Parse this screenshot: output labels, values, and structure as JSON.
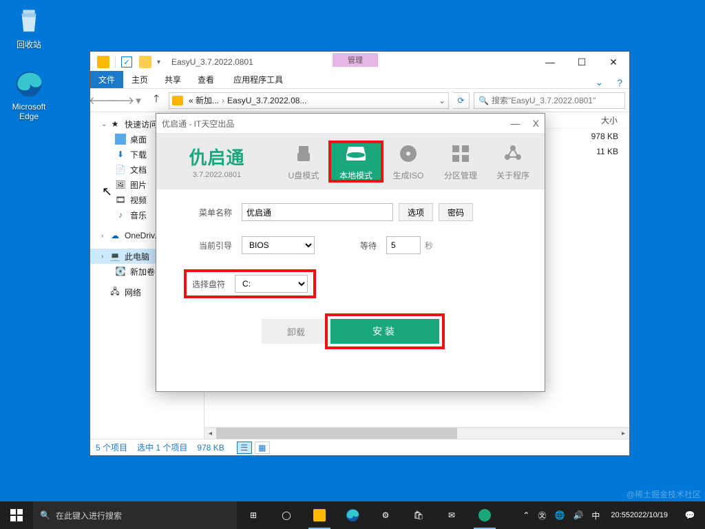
{
  "desktop": {
    "recycle": "回收站",
    "edge": "Microsoft Edge"
  },
  "explorer": {
    "window_title": "EasyU_3.7.2022.0801",
    "tool_tab_header": "管理",
    "tabs": {
      "file": "文件",
      "home": "主页",
      "share": "共享",
      "view": "查看",
      "apptools": "应用程序工具"
    },
    "nav": {
      "breadcrumb_root": "«  新加...",
      "breadcrumb_folder": "EasyU_3.7.2022.08...",
      "search_placeholder": "搜索\"EasyU_3.7.2022.0801\""
    },
    "sidebar": {
      "quick": "快速访问",
      "desktop": "桌面",
      "downloads": "下载",
      "documents": "文档",
      "pictures": "图片",
      "videos": "视频",
      "music": "音乐",
      "onedrive": "OneDriv...",
      "thispc": "此电脑",
      "volume": "新加卷 (...",
      "network": "网络"
    },
    "columns": {
      "size": "大小"
    },
    "rows": [
      {
        "size": "978 KB"
      },
      {
        "size": "11 KB"
      }
    ],
    "status": {
      "count": "5 个项目",
      "selected": "选中 1 个项目",
      "size": "978 KB"
    }
  },
  "easyu": {
    "title": "优启通 - IT天空出品",
    "brand": "仇启通",
    "version": "3.7.2022.0801",
    "tabs": {
      "usb": "U盘模式",
      "local": "本地模式",
      "iso": "生成ISO",
      "part": "分区管理",
      "about": "关于程序"
    },
    "menu_name_label": "菜单名称",
    "menu_name_value": "优启通",
    "options": "选项",
    "password": "密码",
    "boot_label": "当前引导",
    "boot_value": "BIOS",
    "wait_label": "等待",
    "wait_value": "5",
    "seconds": "秒",
    "drive_label": "选择盘符",
    "drive_value": "C:",
    "uninstall": "卸载",
    "install": "安装"
  },
  "taskbar": {
    "search_placeholder": "在此键入进行搜索",
    "time": "20:55",
    "date": "2022/10/19"
  },
  "watermark": "@稀土掘金技术社区"
}
